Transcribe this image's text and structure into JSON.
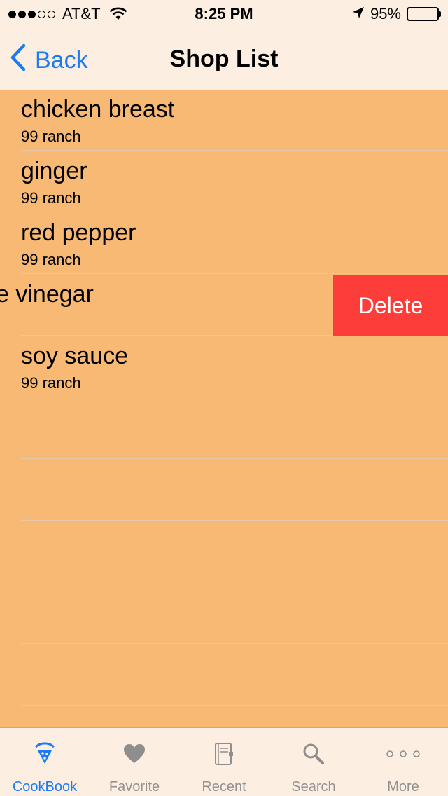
{
  "status_bar": {
    "carrier": "AT&T",
    "time": "8:25 PM",
    "battery_percent": "95%",
    "battery_level": 0.95,
    "signal_bars_filled": 3,
    "signal_bars_total": 5
  },
  "nav": {
    "back_label": "Back",
    "title": "Shop List"
  },
  "rows": [
    {
      "title": "chicken breast",
      "subtitle": "99 ranch"
    },
    {
      "title": "ginger",
      "subtitle": "99 ranch"
    },
    {
      "title": "red pepper",
      "subtitle": "99 ranch"
    },
    {
      "title": "e vinegar",
      "subtitle": "",
      "swiped": true,
      "delete_label": "Delete"
    },
    {
      "title": "soy sauce",
      "subtitle": "99 ranch"
    }
  ],
  "tabs": [
    {
      "label": "CookBook",
      "icon": "cookbook-icon",
      "active": true
    },
    {
      "label": "Favorite",
      "icon": "heart-icon",
      "active": false
    },
    {
      "label": "Recent",
      "icon": "recent-book-icon",
      "active": false
    },
    {
      "label": "Search",
      "icon": "search-icon",
      "active": false
    },
    {
      "label": "More",
      "icon": "more-dots-icon",
      "active": false
    }
  ],
  "colors": {
    "accent": "#1a7cf5",
    "table_background": "#f7b974",
    "bar_background": "#fcefe2",
    "delete": "#fc3d39",
    "inactive_tab": "#929292"
  }
}
